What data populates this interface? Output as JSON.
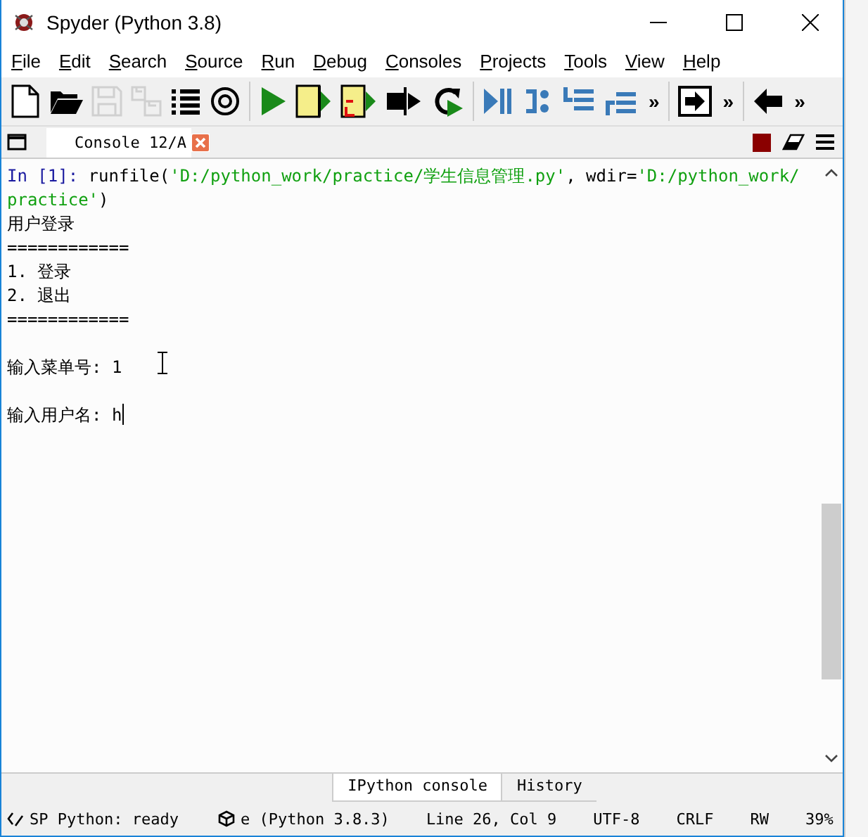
{
  "window": {
    "title": "Spyder (Python 3.8)"
  },
  "menu": [
    {
      "label": "File"
    },
    {
      "label": "Edit"
    },
    {
      "label": "Search"
    },
    {
      "label": "Source"
    },
    {
      "label": "Run"
    },
    {
      "label": "Debug"
    },
    {
      "label": "Consoles"
    },
    {
      "label": "Projects"
    },
    {
      "label": "Tools"
    },
    {
      "label": "View"
    },
    {
      "label": "Help"
    }
  ],
  "toolbar": [
    {
      "kind": "new"
    },
    {
      "kind": "open"
    },
    {
      "kind": "save",
      "disabled": true
    },
    {
      "kind": "save-all",
      "disabled": true
    },
    {
      "kind": "list"
    },
    {
      "kind": "at"
    },
    {
      "kind": "sep"
    },
    {
      "kind": "run"
    },
    {
      "kind": "run-cell"
    },
    {
      "kind": "run-cell-advance"
    },
    {
      "kind": "run-selection"
    },
    {
      "kind": "rerun"
    },
    {
      "kind": "sep"
    },
    {
      "kind": "debug"
    },
    {
      "kind": "step"
    },
    {
      "kind": "step-into"
    },
    {
      "kind": "step-return"
    },
    {
      "kind": "more",
      "text": "»"
    },
    {
      "kind": "sep"
    },
    {
      "kind": "maximize"
    },
    {
      "kind": "more",
      "text": "»"
    },
    {
      "kind": "sep"
    },
    {
      "kind": "back"
    },
    {
      "kind": "more",
      "text": "»"
    }
  ],
  "console_tab": {
    "label": "Console 12/A"
  },
  "console": [
    {
      "kind": "line",
      "segments": [
        {
          "kind": "prompt",
          "text": "In [1]: "
        },
        {
          "kind": "code",
          "text": "runfile("
        },
        {
          "kind": "string",
          "text": "'D:/python_work/practice/学生信息管理.py'"
        },
        {
          "kind": "code",
          "text": ", wdir="
        },
        {
          "kind": "string",
          "text": "'D:/python_work/"
        }
      ]
    },
    {
      "kind": "line",
      "segments": [
        {
          "kind": "string",
          "text": "practice'"
        },
        {
          "kind": "code",
          "text": ")"
        }
      ]
    },
    {
      "kind": "line",
      "segments": [
        {
          "kind": "code",
          "text": "用户登录"
        }
      ]
    },
    {
      "kind": "line",
      "segments": [
        {
          "kind": "code",
          "text": "============"
        }
      ]
    },
    {
      "kind": "line",
      "segments": [
        {
          "kind": "code",
          "text": "1. 登录"
        }
      ]
    },
    {
      "kind": "line",
      "segments": [
        {
          "kind": "code",
          "text": "2. 退出"
        }
      ]
    },
    {
      "kind": "line",
      "segments": [
        {
          "kind": "code",
          "text": "============"
        }
      ]
    },
    {
      "kind": "blank"
    },
    {
      "kind": "line",
      "segments": [
        {
          "kind": "code",
          "text": "输入菜单号: 1"
        }
      ]
    },
    {
      "kind": "blank"
    },
    {
      "kind": "line",
      "segments": [
        {
          "kind": "code",
          "text": "输入用户名: h"
        },
        {
          "kind": "caret"
        }
      ]
    }
  ],
  "pane_tabs": [
    {
      "label": "IPython console",
      "selected": true
    },
    {
      "label": "History",
      "selected": false
    }
  ],
  "status_bar": [
    {
      "kind": "lsp",
      "text": "SP Python: ready"
    },
    {
      "kind": "env",
      "text": "e (Python 3.8.3)"
    },
    {
      "kind": "text",
      "text": "Line 26, Col 9"
    },
    {
      "kind": "text",
      "text": "UTF-8"
    },
    {
      "kind": "text",
      "text": "CRLF"
    },
    {
      "kind": "text",
      "text": "RW"
    },
    {
      "kind": "text",
      "text": "39%"
    }
  ]
}
